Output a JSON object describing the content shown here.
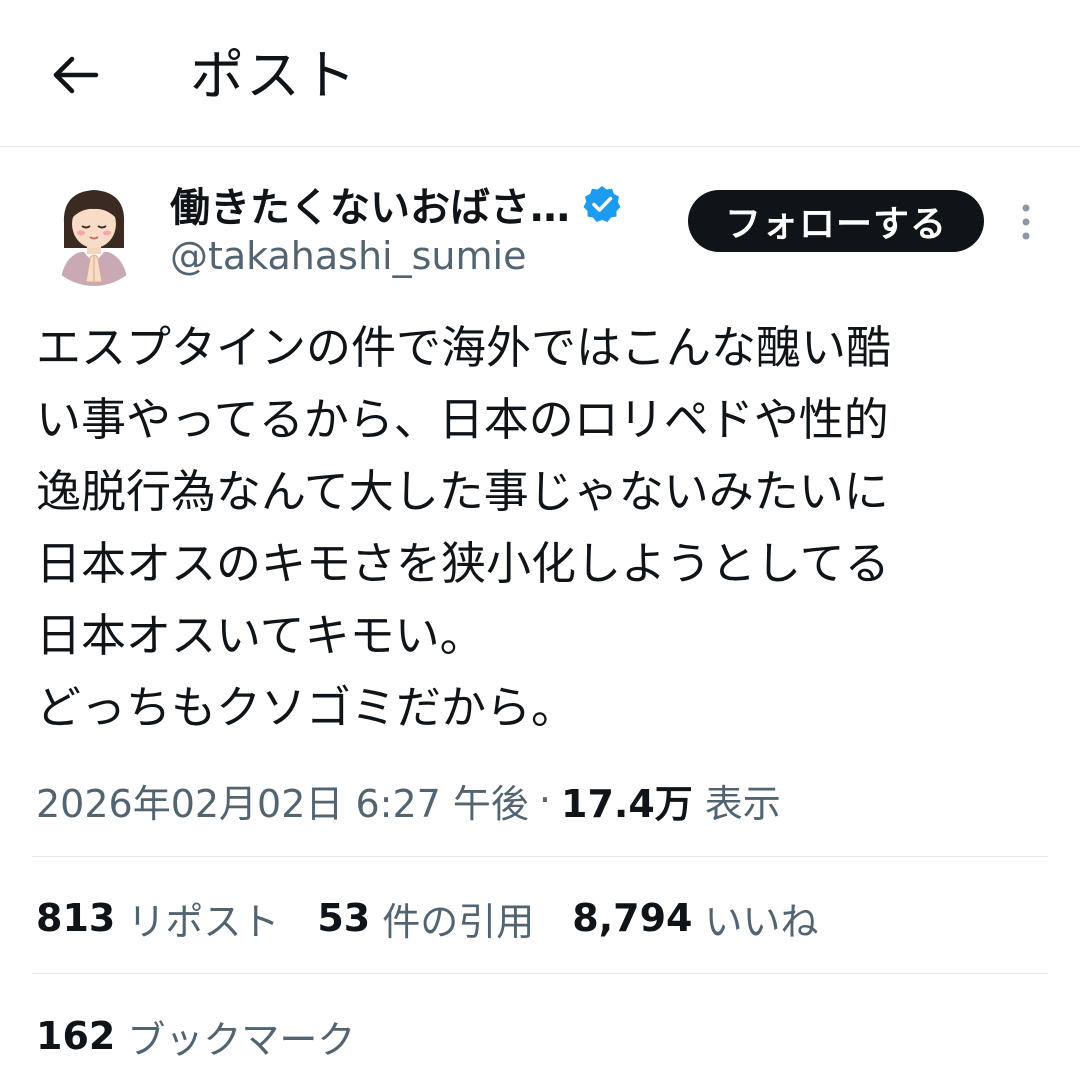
{
  "header": {
    "title": "ポスト",
    "back_icon": "arrow-left-icon"
  },
  "author": {
    "display_name": "働きたくないおばさ…",
    "handle": "@takahashi_sumie",
    "verified": true,
    "verified_color": "#1d9bf0",
    "avatar_icon": "illustrated-woman-avatar"
  },
  "follow_button": {
    "label": "フォローする"
  },
  "more_icon": "more-vertical-icon",
  "tweet": {
    "lines": [
      "エスプタインの件で海外ではこんな醜い酷",
      "い事やってるから、日本のロリペドや性的",
      "逸脱行為なんて大した事じゃないみたいに",
      "日本オスのキモさを狭小化しようとしてる",
      "日本オスいてキモい。",
      "どっちもクソゴミだから。"
    ]
  },
  "meta": {
    "timestamp": "2026年02月02日 6:27 午後",
    "separator": "·",
    "views_count": "17.4万",
    "views_label": "表示"
  },
  "stats": [
    {
      "count": "813",
      "label": "リポスト"
    },
    {
      "count": "53",
      "label": "件の引用"
    },
    {
      "count": "8,794",
      "label": "いいね"
    }
  ],
  "bookmarks": {
    "count": "162",
    "label": "ブックマーク"
  },
  "colors": {
    "text_primary": "#0f1419",
    "text_secondary": "#536471",
    "divider": "#e6e9ec",
    "button_bg": "#0f1419"
  }
}
